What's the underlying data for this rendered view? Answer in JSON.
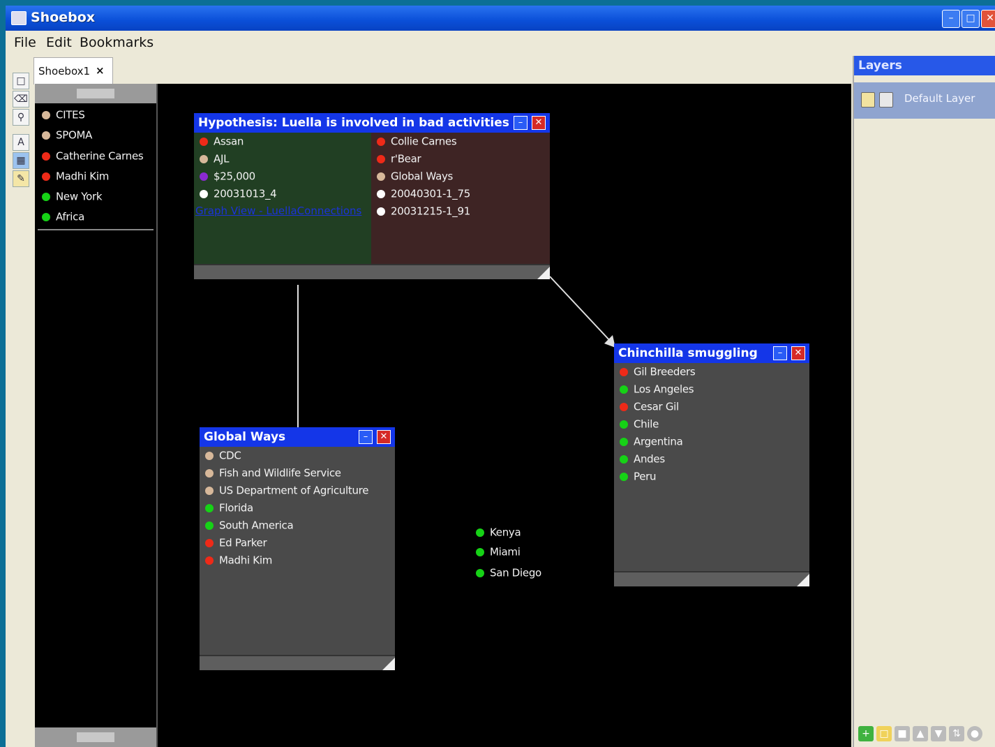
{
  "window": {
    "title": "Shoebox"
  },
  "menu": [
    "File",
    "Edit",
    "Bookmarks"
  ],
  "tab": {
    "label": "Shoebox1",
    "close": "×"
  },
  "colors": {
    "red": "#ee2a18",
    "tan": "#d7b89a",
    "green": "#16d216",
    "white": "#ffffff",
    "purple": "#8a2ad0"
  },
  "bookmarks": [
    {
      "label": "CITES",
      "color": "tan"
    },
    {
      "label": "SPOMA",
      "color": "tan"
    },
    {
      "label": "Catherine Carnes",
      "color": "red"
    },
    {
      "label": "Madhi Kim",
      "color": "red"
    },
    {
      "label": "New York",
      "color": "green"
    },
    {
      "label": "Africa",
      "color": "green"
    }
  ],
  "hypothesis": {
    "title": "Hypothesis: Luella is involved in bad activities",
    "left": [
      {
        "label": "Assan",
        "color": "red"
      },
      {
        "label": "AJL",
        "color": "tan"
      },
      {
        "label": "$25,000",
        "color": "purple"
      },
      {
        "label": "20031013_4",
        "color": "white"
      }
    ],
    "link": "Graph View - LuellaConnections",
    "right": [
      {
        "label": "Collie Carnes",
        "color": "red"
      },
      {
        "label": "r'Bear",
        "color": "red"
      },
      {
        "label": "Global Ways",
        "color": "tan"
      },
      {
        "label": "20040301-1_75",
        "color": "white"
      },
      {
        "label": "20031215-1_91",
        "color": "white"
      }
    ]
  },
  "global_ways": {
    "title": "Global Ways",
    "items": [
      {
        "label": "CDC",
        "color": "tan"
      },
      {
        "label": "Fish and Wildlife Service",
        "color": "tan"
      },
      {
        "label": "US Department of Agriculture",
        "color": "tan"
      },
      {
        "label": "Florida",
        "color": "green"
      },
      {
        "label": "South America",
        "color": "green"
      },
      {
        "label": "Ed Parker",
        "color": "red"
      },
      {
        "label": "Madhi Kim",
        "color": "red"
      }
    ]
  },
  "chinchilla": {
    "title": "Chinchilla smuggling",
    "items": [
      {
        "label": "Gil Breeders",
        "color": "red"
      },
      {
        "label": "Los Angeles",
        "color": "green"
      },
      {
        "label": "Cesar Gil",
        "color": "red"
      },
      {
        "label": "Chile",
        "color": "green"
      },
      {
        "label": "Argentina",
        "color": "green"
      },
      {
        "label": "Andes",
        "color": "green"
      },
      {
        "label": "Peru",
        "color": "green"
      }
    ]
  },
  "loose_items": [
    {
      "label": "Kenya",
      "color": "green"
    },
    {
      "label": "Miami",
      "color": "green"
    },
    {
      "label": "San Diego",
      "color": "green"
    }
  ],
  "layers": {
    "title": "Layers",
    "default_layer": "Default Layer"
  }
}
